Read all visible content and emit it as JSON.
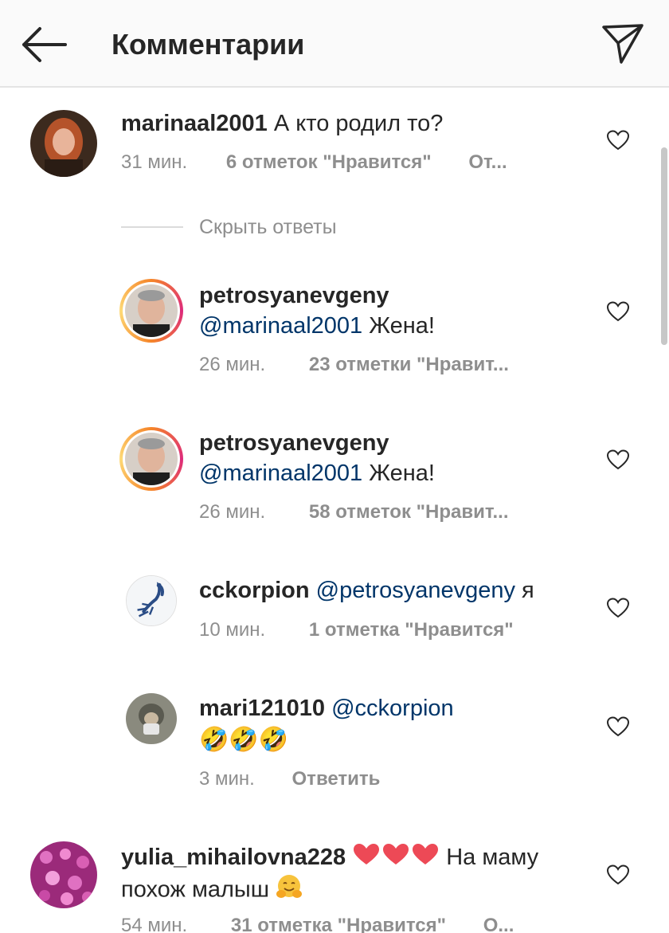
{
  "header": {
    "title": "Комментарии",
    "back_icon": "arrow-left-icon",
    "direct_icon": "paper-plane-icon"
  },
  "comments": [
    {
      "username": "marinaal2001",
      "text": "А кто родил то?",
      "time": "31 мин.",
      "likes": "6 отметок \"Нравится\"",
      "reply": "От..."
    }
  ],
  "hide_replies": "Скрыть ответы",
  "replies": [
    {
      "username": "petrosyanevgeny",
      "mention": "@marinaal2001",
      "text": "Жена!",
      "time": "26 мин.",
      "likes": "23 отметки \"Нравит..."
    },
    {
      "username": "petrosyanevgeny",
      "mention": "@marinaal2001",
      "text": "Жена!",
      "time": "26 мин.",
      "likes": "58 отметок \"Нравит..."
    },
    {
      "username": "cckorpion",
      "mention": "@petrosyanevgeny",
      "text": "я",
      "time": "10 мин.",
      "likes": "1 отметка \"Нравится\""
    },
    {
      "username": "mari121010",
      "mention": "@cckorpion",
      "text": "🤣🤣🤣",
      "time": "3 мин.",
      "reply": "Ответить"
    }
  ],
  "last_comment": {
    "username": "yulia_mihailovna228",
    "line1_text": "На маму",
    "line2_text": "похож малыш",
    "time": "54 мин.",
    "likes": "31 отметка \"Нравится\"",
    "reply": "О..."
  },
  "colors": {
    "mention": "#003569",
    "meta": "#8e8e8e",
    "heart_red": "#ed4956"
  }
}
